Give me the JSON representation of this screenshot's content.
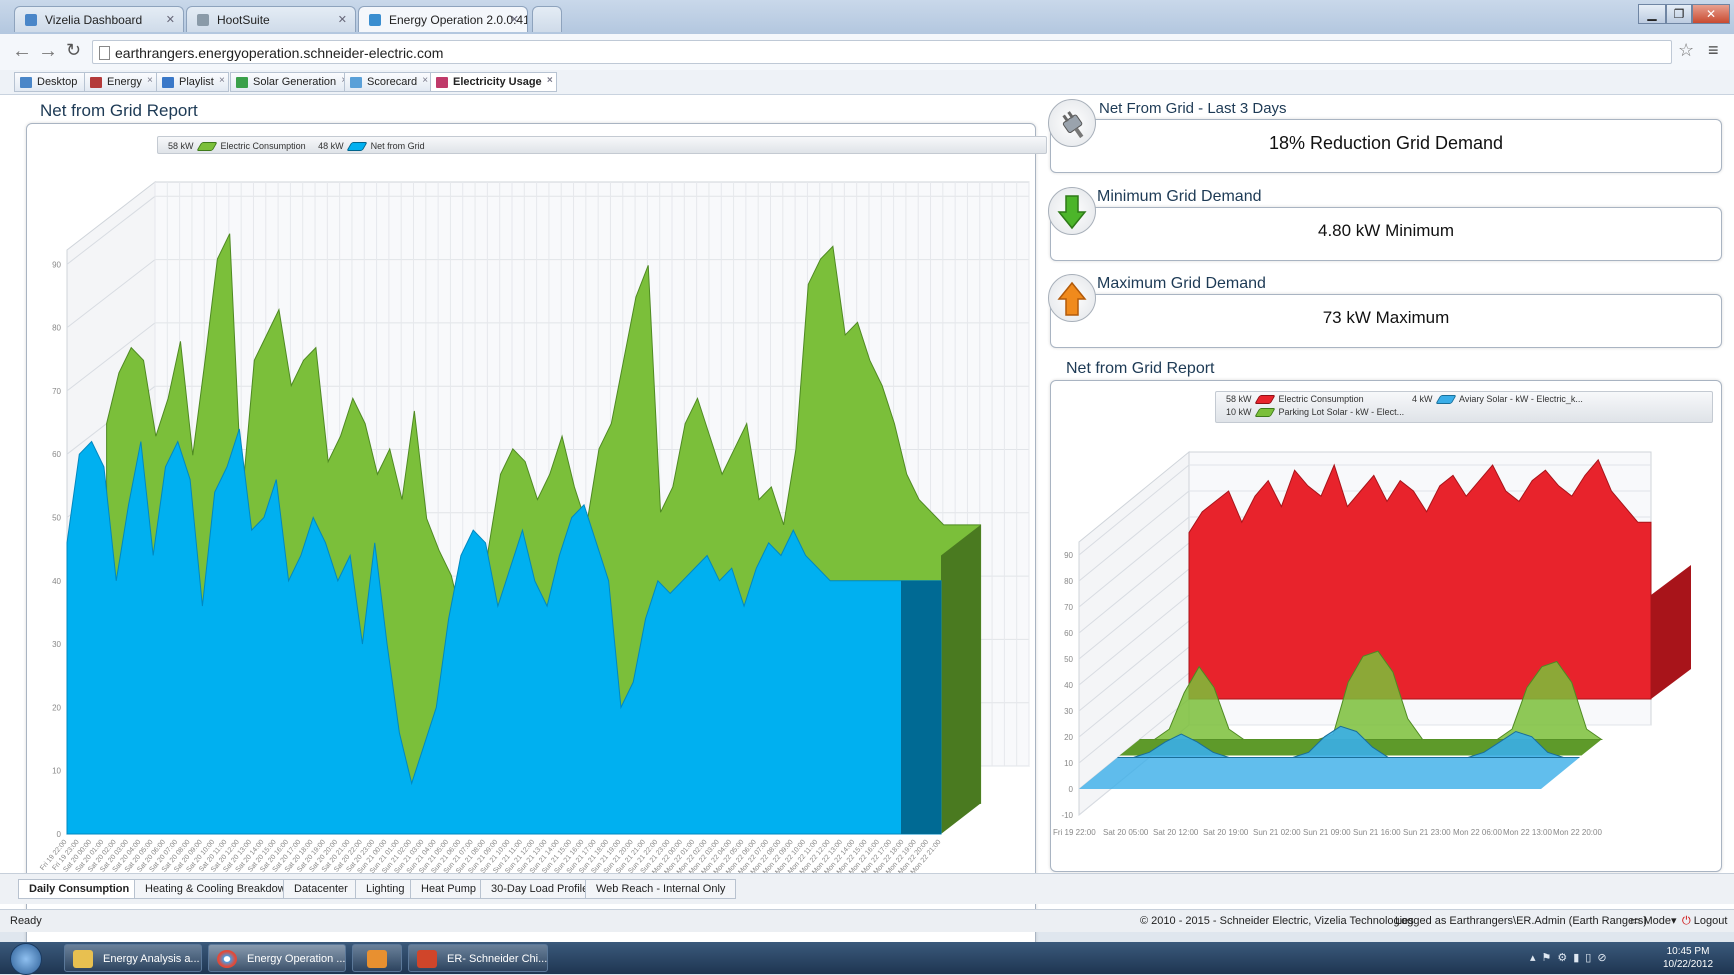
{
  "browser": {
    "tabs": [
      {
        "label": "Vizelia Dashboard",
        "icon": "page-icon"
      },
      {
        "label": "HootSuite",
        "icon": "owl-icon"
      },
      {
        "label": "Energy Operation 2.0.0.41",
        "icon": "energy-icon"
      }
    ],
    "url": "earthrangers.energyoperation.schneider-electric.com",
    "window_controls": [
      "minimize",
      "restore",
      "close"
    ]
  },
  "bookmarks": [
    {
      "label": "Desktop",
      "color": "#4a86c8"
    },
    {
      "label": "Energy",
      "color": "#b43a3a"
    },
    {
      "label": "Playlist",
      "color": "#3a78c8"
    },
    {
      "label": "Solar Generation",
      "color": "#3aa04a"
    },
    {
      "label": "Scorecard",
      "color": "#5aa0d8"
    },
    {
      "label": "Electricity Usage",
      "color": "#c03a6a"
    }
  ],
  "main_chart": {
    "title": "Net from Grid Report",
    "legend": [
      {
        "value": "58 kW",
        "name": "Electric Consumption",
        "color": "#7bbf3a"
      },
      {
        "value": "48 kW",
        "name": "Net from Grid",
        "color": "#00b0f0"
      }
    ],
    "y_ticks": [
      "0",
      "10",
      "20",
      "30",
      "40",
      "50",
      "60",
      "70",
      "80",
      "90"
    ],
    "x_ticks": [
      "Fri 19 22:00",
      "Fri 19 23:00",
      "Sat 20 00:00",
      "Sat 20 01:00",
      "Sat 20 02:00",
      "Sat 20 03:00",
      "Sat 20 04:00",
      "Sat 20 05:00",
      "Sat 20 06:00",
      "Sat 20 07:00",
      "Sat 20 08:00",
      "Sat 20 09:00",
      "Sat 20 10:00",
      "Sat 20 11:00",
      "Sat 20 12:00",
      "Sat 20 13:00",
      "Sat 20 14:00",
      "Sat 20 15:00",
      "Sat 20 16:00",
      "Sat 20 17:00",
      "Sat 20 18:00",
      "Sat 20 19:00",
      "Sat 20 20:00",
      "Sat 20 21:00",
      "Sat 20 22:00",
      "Sat 20 23:00",
      "Sun 21 00:00",
      "Sun 21 01:00",
      "Sun 21 02:00",
      "Sun 21 03:00",
      "Sun 21 04:00",
      "Sun 21 05:00",
      "Sun 21 06:00",
      "Sun 21 07:00",
      "Sun 21 08:00",
      "Sun 21 09:00",
      "Sun 21 10:00",
      "Sun 21 11:00",
      "Sun 21 12:00",
      "Sun 21 13:00",
      "Sun 21 14:00",
      "Sun 21 15:00",
      "Sun 21 16:00",
      "Sun 21 17:00",
      "Sun 21 18:00",
      "Sun 21 19:00",
      "Sun 21 20:00",
      "Sun 21 21:00",
      "Sun 21 22:00",
      "Sun 21 23:00",
      "Mon 22 00:00",
      "Mon 22 01:00",
      "Mon 22 02:00",
      "Mon 22 03:00",
      "Mon 22 04:00",
      "Mon 22 05:00",
      "Mon 22 06:00",
      "Mon 22 07:00",
      "Mon 22 08:00",
      "Mon 22 09:00",
      "Mon 22 10:00",
      "Mon 22 11:00",
      "Mon 22 12:00",
      "Mon 22 13:00",
      "Mon 22 14:00",
      "Mon 22 15:00",
      "Mon 22 16:00",
      "Mon 22 17:00",
      "Mon 22 18:00",
      "Mon 22 19:00",
      "Mon 22 20:00",
      "Mon 22 21:00"
    ]
  },
  "kpis": [
    {
      "title": "Net From Grid - Last 3 Days",
      "value": "18% Reduction Grid Demand",
      "icon": "plug-icon"
    },
    {
      "title": "Minimum Grid Demand",
      "value": "4.80  kW Minimum",
      "icon": "arrow-down-icon"
    },
    {
      "title": "Maximum Grid Demand",
      "value": "73  kW Maximum",
      "icon": "arrow-up-icon"
    }
  ],
  "side_chart": {
    "title": "Net from Grid Report",
    "legend": [
      {
        "value": "58 kW",
        "name": "Electric Consumption",
        "color": "#e8232c"
      },
      {
        "value": "4 kW",
        "name": "Aviary Solar - kW - Electric_k...",
        "color": "#3aaee8"
      },
      {
        "value": "10 kW",
        "name": "Parking Lot Solar - kW - Elect...",
        "color": "#7bbf3a"
      }
    ],
    "y_ticks": [
      "-10",
      "0",
      "10",
      "20",
      "30",
      "40",
      "50",
      "60",
      "70",
      "80",
      "90"
    ],
    "x_ticks": [
      "Fri 19 22:00",
      "Sat 20 05:00",
      "Sat 20 12:00",
      "Sat 20 19:00",
      "Sun 21 02:00",
      "Sun 21 09:00",
      "Sun 21 16:00",
      "Sun 21 23:00",
      "Mon 22 06:00",
      "Mon 22 13:00",
      "Mon 22 20:00"
    ]
  },
  "bottom_tabs": [
    "Daily Consumption",
    "Heating & Cooling Breakdown",
    "Datacenter",
    "Lighting",
    "Heat Pump",
    "30-Day Load Profile",
    "Web Reach - Internal Only"
  ],
  "status": {
    "left": "Ready",
    "copyright": "© 2010 - 2015 - Schneider Electric, Vizelia Technologies",
    "logged": "Logged as Earthrangers\\ER.Admin (Earth Rangers)",
    "mode": "Mode",
    "logout": "Logout"
  },
  "taskbar": {
    "items": [
      {
        "label": "Energy Analysis a...",
        "color": "#e8c050"
      },
      {
        "label": "Energy Operation ...",
        "color": "#4a9be0"
      },
      {
        "label": "",
        "color": "#e89030"
      },
      {
        "label": "ER- Schneider Chi...",
        "color": "#d0452a"
      }
    ],
    "time": "10:45 PM",
    "date": "10/22/2012"
  }
}
